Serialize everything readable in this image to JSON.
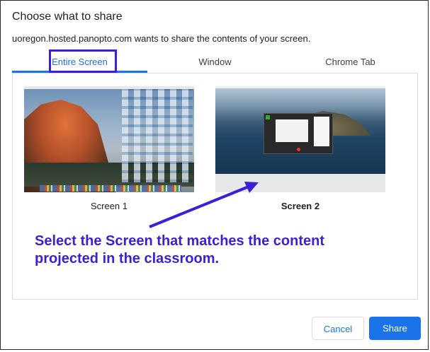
{
  "dialog": {
    "title": "Choose what to share",
    "subtitle": "uoregon.hosted.panopto.com wants to share the contents of your screen."
  },
  "tabs": [
    {
      "label": "Entire Screen",
      "active": true
    },
    {
      "label": "Window",
      "active": false
    },
    {
      "label": "Chrome Tab",
      "active": false
    }
  ],
  "screens": [
    {
      "label": "Screen 1",
      "selected": false
    },
    {
      "label": "Screen 2",
      "selected": true
    }
  ],
  "annotation": {
    "text": "Select the Screen that matches the content projected in the classroom."
  },
  "buttons": {
    "cancel": "Cancel",
    "share": "Share"
  },
  "colors": {
    "accent": "#1a73e8",
    "annotation": "#3b1fd6"
  }
}
